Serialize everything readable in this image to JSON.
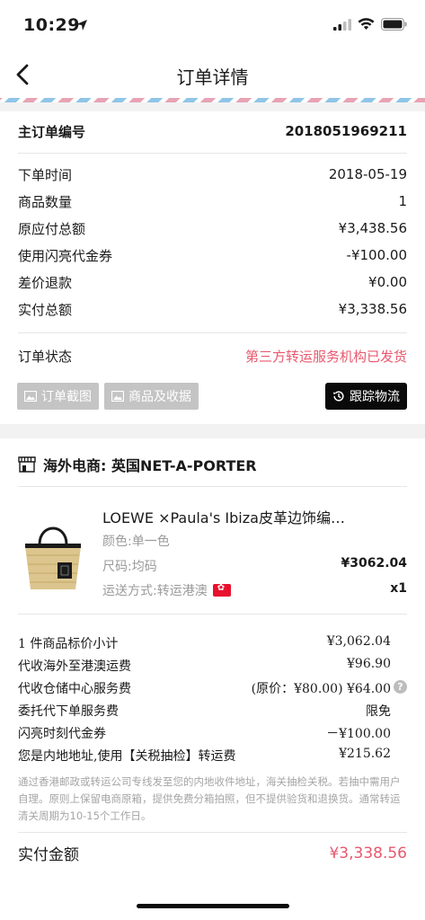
{
  "status": {
    "time": "10:29"
  },
  "nav": {
    "title": "订单详情"
  },
  "order": {
    "id_label": "主订单编号",
    "id_value": "2018051969211",
    "rows": [
      {
        "label": "下单时间",
        "value": "2018-05-19"
      },
      {
        "label": "商品数量",
        "value": "1"
      },
      {
        "label": "原应付总额",
        "value": "¥3,438.56"
      },
      {
        "label": "使用闪亮代金券",
        "value": "-¥100.00"
      },
      {
        "label": "差价退款",
        "value": "¥0.00"
      },
      {
        "label": "实付总额",
        "value": "¥3,338.56"
      }
    ],
    "status_label": "订单状态",
    "status_value": "第三方转运服务机构已发货",
    "screenshot_btn": "订单截图",
    "goods_btn": "商品及收据",
    "track_btn": "跟踪物流"
  },
  "store": {
    "label": "海外电商: 英国NET-A-PORTER"
  },
  "product": {
    "title": "LOEWE ×Paula's Ibiza皮革边饰编…",
    "color": "颜色:单一色",
    "size": "尺码:均码",
    "price": "¥3062.04",
    "shipping": "运送方式:转运港澳",
    "qty": "x1"
  },
  "fees": [
    {
      "label": "1 件商品标价小计",
      "value": "¥3,062.04"
    },
    {
      "label": "代收海外至港澳运费",
      "value": "¥96.90"
    },
    {
      "label": "代收仓储中心服务费",
      "value": "(原价：¥80.00) ¥64.00"
    },
    {
      "label": "委托代下单服务费",
      "value": "限免"
    },
    {
      "label": "闪亮时刻代金券",
      "value": "－¥100.00"
    },
    {
      "label": "您是内地地址,使用【关税抽检】转运费",
      "value": "¥215.62"
    }
  ],
  "notice": "通过香港邮政或转运公司专线发至您的内地收件地址，海关抽检关税。若抽中需用户自理。原则上保留电商原箱，提供免费分箱拍照，但不提供验货和退换货。通常转运清关周期为10-15个工作日。",
  "total": {
    "label": "实付金额",
    "value": "¥3,338.56"
  },
  "colors": {
    "accent": "#e8586e",
    "button_grey": "#c4c4c4",
    "button_dark": "#0a0a0a"
  }
}
